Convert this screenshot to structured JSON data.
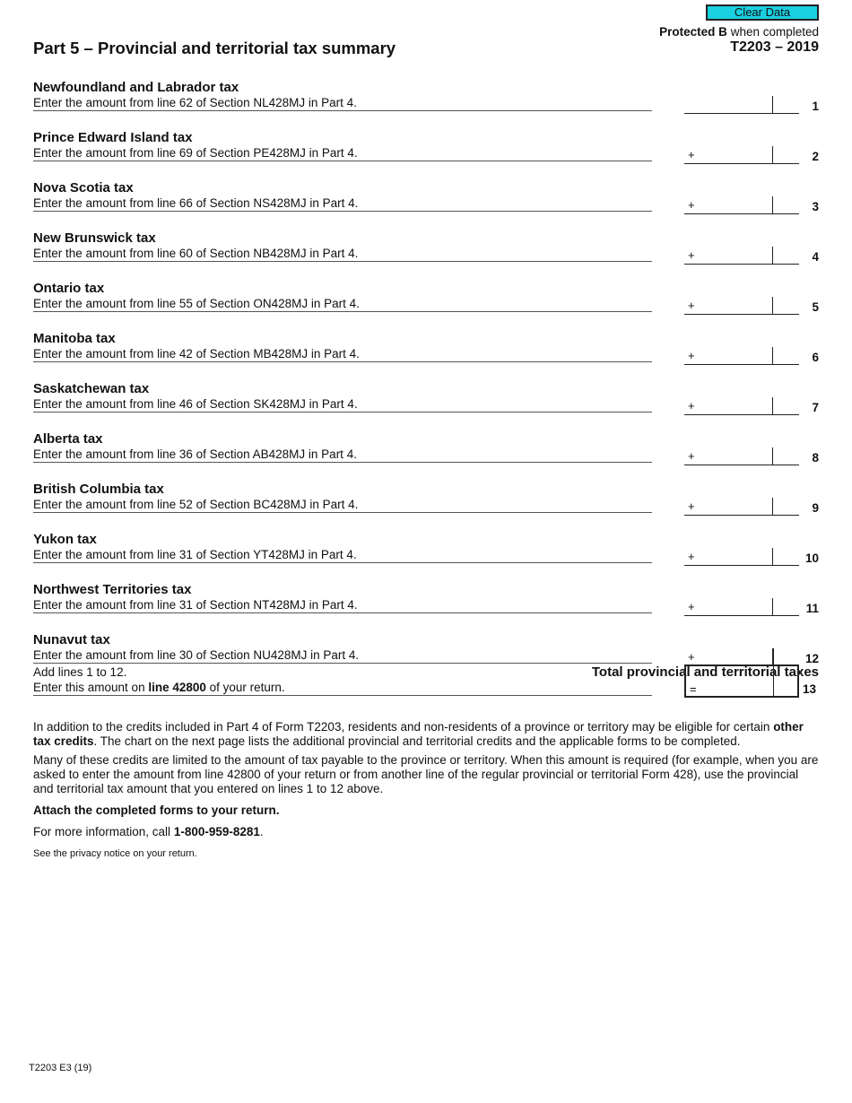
{
  "header": {
    "clear_button": "Clear Data",
    "protected_bold": "Protected B",
    "protected_rest": " when completed",
    "form_number": "T2203 – 2019",
    "part_title": "Part 5 – Provincial and territorial tax summary"
  },
  "lines": [
    {
      "title": "Newfoundland and Labrador tax",
      "desc": "Enter the amount from line 62 of Section NL428MJ in Part 4.",
      "sign": "",
      "number": "1",
      "value": ""
    },
    {
      "title": "Prince Edward Island tax",
      "desc": "Enter the amount from line 69 of Section PE428MJ in Part 4.",
      "sign": "+",
      "number": "2",
      "value": ""
    },
    {
      "title": "Nova Scotia tax",
      "desc": "Enter the amount from line 66 of Section NS428MJ in Part 4.",
      "sign": "+",
      "number": "3",
      "value": ""
    },
    {
      "title": "New Brunswick tax",
      "desc": "Enter the amount from line 60 of Section NB428MJ in Part 4.",
      "sign": "+",
      "number": "4",
      "value": ""
    },
    {
      "title": "Ontario tax",
      "desc": "Enter the amount from line 55 of Section ON428MJ in Part 4.",
      "sign": "+",
      "number": "5",
      "value": ""
    },
    {
      "title": "Manitoba tax",
      "desc": "Enter the amount from line 42 of Section MB428MJ in Part 4.",
      "sign": "+",
      "number": "6",
      "value": ""
    },
    {
      "title": "Saskatchewan tax",
      "desc": "Enter the amount from line 46 of Section SK428MJ in Part 4.",
      "sign": "+",
      "number": "7",
      "value": ""
    },
    {
      "title": "Alberta tax",
      "desc": "Enter the amount from line 36 of Section AB428MJ in Part 4.",
      "sign": "+",
      "number": "8",
      "value": ""
    },
    {
      "title": "British Columbia tax",
      "desc": "Enter the amount from line 52 of Section BC428MJ in Part 4.",
      "sign": "+",
      "number": "9",
      "value": ""
    },
    {
      "title": "Yukon tax",
      "desc": "Enter the amount from line 31 of Section YT428MJ in Part 4.",
      "sign": "+",
      "number": "10",
      "value": ""
    },
    {
      "title": "Northwest Territories tax",
      "desc": "Enter the amount from line 31 of Section NT428MJ in Part 4.",
      "sign": "+",
      "number": "11",
      "value": ""
    },
    {
      "title": "Nunavut tax",
      "desc": "Enter the amount from line 30 of Section NU428MJ in Part 4.",
      "sign": "+",
      "number": "12",
      "value": ""
    }
  ],
  "total": {
    "line1": "Add lines 1 to 12.",
    "line2_pre": "Enter this amount on ",
    "line2_bold": "line 42800",
    "line2_post": " of your return.",
    "label": "Total provincial and territorial taxes",
    "sign": "=",
    "number": "13",
    "value": ""
  },
  "notes": {
    "p1_pre": "In addition to the credits included in Part 4 of Form T2203, residents and non-residents of a province or territory may be eligible for certain ",
    "p1_bold": "other tax credits",
    "p1_post": ". The chart on the next page lists the additional provincial and territorial credits and the applicable forms to be completed.",
    "p2": "Many of these credits are limited to the amount of tax payable to the province or territory. When this amount is required (for example, when you are asked to enter the amount from line 42800 of your return or from another line of the regular provincial or territorial Form 428), use the provincial and territorial tax amount that you entered on lines 1 to 12 above.",
    "attach": "Attach the completed forms to your return.",
    "info_pre": "For more information, call ",
    "info_phone": "1-800-959-8281",
    "info_post": ".",
    "privacy": "See the privacy notice on your return."
  },
  "footer": {
    "code": "T2203 E3 (19)"
  }
}
